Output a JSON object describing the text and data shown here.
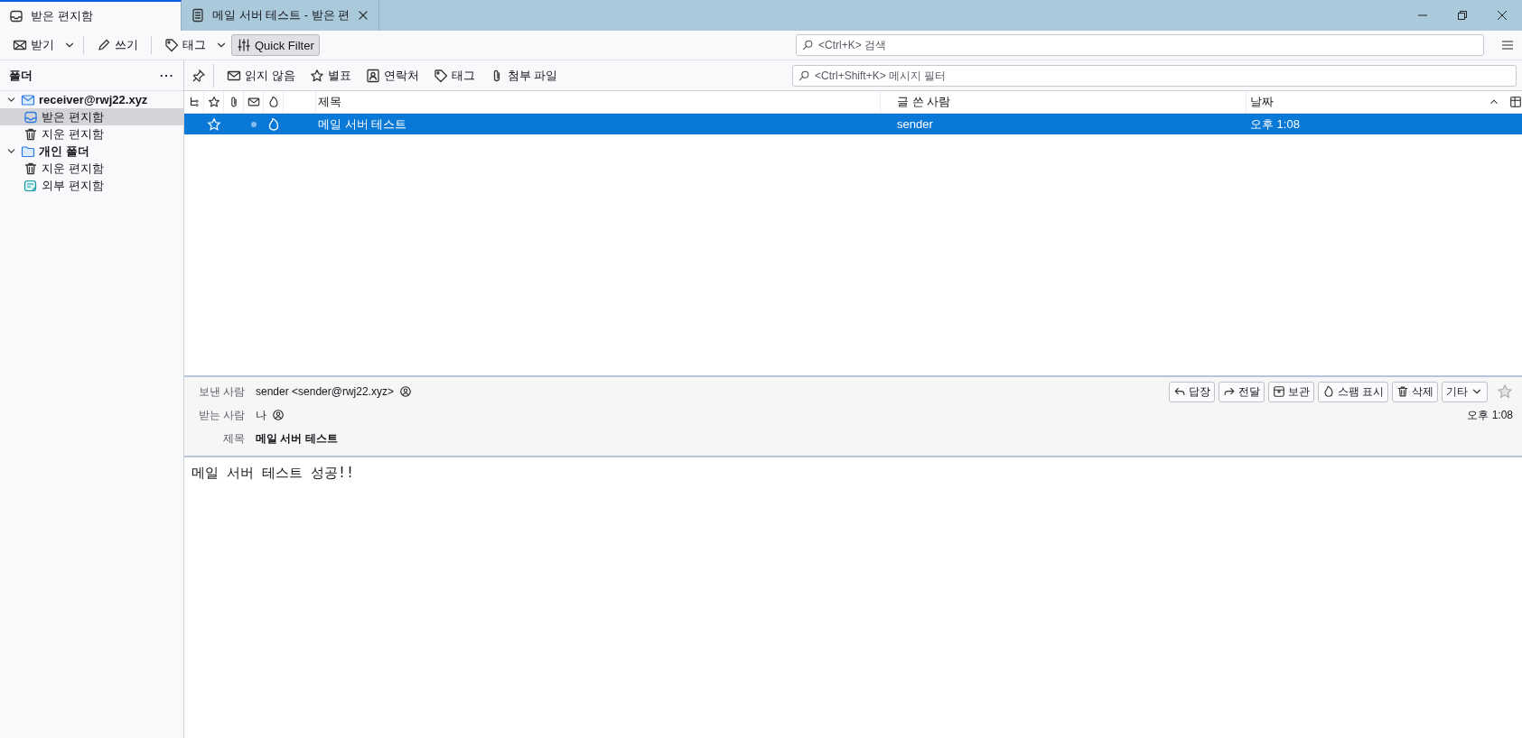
{
  "tabs": [
    {
      "label": "받은 편지함",
      "kind": "inbox",
      "selected": true,
      "closable": false
    },
    {
      "label": "메일 서버 테스트 - 받은 편",
      "kind": "message",
      "selected": false,
      "closable": true
    }
  ],
  "toolbar": {
    "buttons": [
      {
        "label": "받기",
        "kind": "get",
        "menu": true,
        "pressed": false
      },
      {
        "label": "쓰기",
        "kind": "write",
        "menu": false,
        "pressed": false
      },
      {
        "label": "태그",
        "kind": "tag",
        "menu": true,
        "pressed": false
      },
      {
        "label": "Quick Filter",
        "kind": "filter",
        "menu": false,
        "pressed": true
      }
    ],
    "search": {
      "placeholder": "<Ctrl+K> 검색"
    }
  },
  "sidebar": {
    "title": "폴더",
    "menu": "···",
    "items": [
      {
        "label": "receiver@rwj22.xyz",
        "kind": "account",
        "selected": false,
        "expanded": true,
        "children": [
          {
            "label": "받은 편지함",
            "kind": "inbox",
            "selected": true
          },
          {
            "label": "지운 편지함",
            "kind": "trash",
            "selected": false
          }
        ]
      },
      {
        "label": "개인 폴더",
        "kind": "folder",
        "selected": false,
        "expanded": true,
        "children": [
          {
            "label": "지운 편지함",
            "kind": "trash",
            "selected": false
          },
          {
            "label": "외부 편지함",
            "kind": "outbox",
            "selected": false
          }
        ]
      }
    ]
  },
  "quick_filter": {
    "buttons": [
      {
        "label": "읽지 않음",
        "kind": "unread",
        "selected": false
      },
      {
        "label": "별표",
        "kind": "star",
        "selected": false
      },
      {
        "label": "연락처",
        "kind": "contact",
        "selected": false
      },
      {
        "label": "태그",
        "kind": "tag",
        "selected": false
      },
      {
        "label": "첨부 파일",
        "kind": "attach",
        "selected": false
      }
    ],
    "placeholder": "<Ctrl+Shift+K> 메시지 필터"
  },
  "table": {
    "columns": [
      "제목",
      "글 쓴 사람",
      "날짜"
    ],
    "rows": [
      {
        "subject": "메일 서버 테스트",
        "sender": "sender",
        "date": "오후 1:08",
        "selected": true,
        "starred": false
      }
    ]
  },
  "message": {
    "from_label": "보낸 사람",
    "from": "sender <sender@rwj22.xyz>",
    "to_label": "받는 사람",
    "to": "나",
    "subject_label": "제목",
    "subject": "메일 서버 테스트",
    "date": "오후 1:08",
    "actions": [
      {
        "label": "답장",
        "kind": "reply"
      },
      {
        "label": "전달",
        "kind": "forward"
      },
      {
        "label": "보관",
        "kind": "archive"
      },
      {
        "label": "스팸 표시",
        "kind": "spam"
      },
      {
        "label": "삭제",
        "kind": "delete"
      },
      {
        "label": "기타",
        "kind": "more"
      }
    ],
    "starred": false,
    "body": "메일 서버 테스트 성공!!"
  }
}
